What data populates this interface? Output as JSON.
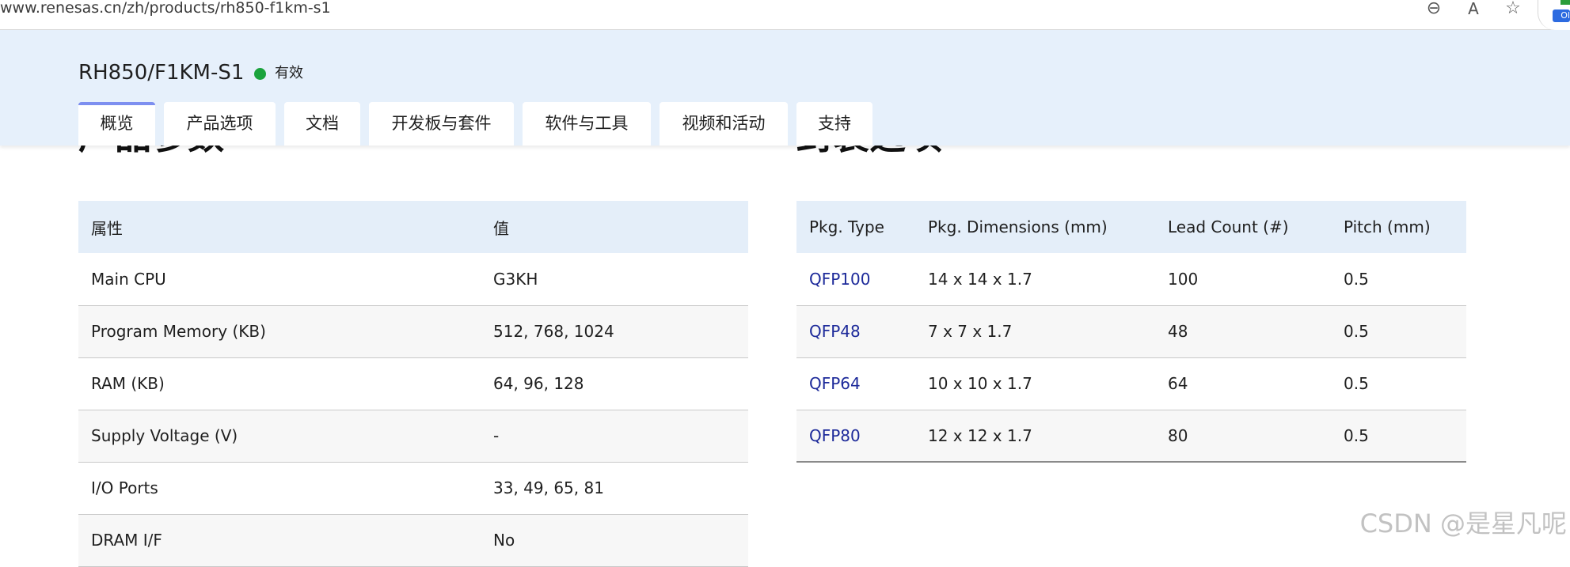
{
  "browser": {
    "url": "www.renesas.cn/zh/products/rh850-f1km-s1",
    "icons": [
      "zoom-out-icon",
      "read-aloud-icon",
      "favorite-star-icon"
    ]
  },
  "product": {
    "name": "RH850/F1KM-S1",
    "status": "有效",
    "status_color": "#1aa33c",
    "tabs": [
      "概览",
      "产品选项",
      "文档",
      "开发板与套件",
      "软件与工具",
      "视频和活动",
      "支持"
    ],
    "active_tab": "概览"
  },
  "sections": {
    "left_heading": "产品参数",
    "right_heading": "封装选项"
  },
  "params_table": {
    "headers": [
      "属性",
      "值"
    ],
    "rows": [
      [
        "Main CPU",
        "G3KH"
      ],
      [
        "Program Memory (KB)",
        "512, 768, 1024"
      ],
      [
        "RAM (KB)",
        "64, 96, 128"
      ],
      [
        "Supply Voltage (V)",
        "-"
      ],
      [
        "I/O Ports",
        "33, 49, 65, 81"
      ],
      [
        "DRAM I/F",
        "No"
      ]
    ]
  },
  "package_table": {
    "headers": [
      "Pkg. Type",
      "Pkg. Dimensions (mm)",
      "Lead Count (#)",
      "Pitch (mm)"
    ],
    "rows": [
      [
        "QFP100",
        "14 x 14 x 1.7",
        "100",
        "0.5"
      ],
      [
        "QFP48",
        "7 x 7 x 1.7",
        "48",
        "0.5"
      ],
      [
        "QFP64",
        "10 x 10 x 1.7",
        "64",
        "0.5"
      ],
      [
        "QFP80",
        "12 x 12 x 1.7",
        "80",
        "0.5"
      ]
    ]
  },
  "watermark": "CSDN @是星凡呢",
  "colors": {
    "header_bg": "#e6f0fb",
    "table_header_bg": "#e4eef9",
    "link": "#1d2a9a",
    "active_tab_accent": "#7d8ff0"
  }
}
